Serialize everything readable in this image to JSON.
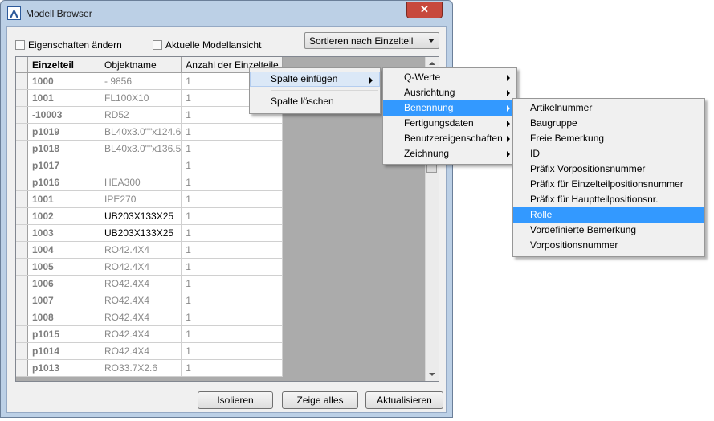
{
  "window": {
    "title": "Modell Browser",
    "close_glyph": "✕"
  },
  "options": {
    "checkbox1_label": "Eigenschaften ändern",
    "checkbox2_label": "Aktuelle Modellansicht",
    "sort_value": "Sortieren nach Einzelteil"
  },
  "table": {
    "columns": [
      "Einzelteil",
      "Objektname",
      "Anzahl der Einzelteile"
    ],
    "rows": [
      {
        "c1": "1000",
        "c2": "- 9856",
        "c3": "1"
      },
      {
        "c1": "1001",
        "c2": "FL100X10",
        "c3": "1"
      },
      {
        "c1": "-10003",
        "c2": "RD52",
        "c3": "1"
      },
      {
        "c1": "p1019",
        "c2": "BL40x3.0\"\"x124.6",
        "c3": "1"
      },
      {
        "c1": "p1018",
        "c2": "BL40x3.0\"\"x136.5",
        "c3": "1"
      },
      {
        "c1": "p1017",
        "c2": "",
        "c3": "1"
      },
      {
        "c1": "p1016",
        "c2": "HEA300",
        "c3": "1"
      },
      {
        "c1": "1001",
        "c2": "IPE270",
        "c3": "1"
      },
      {
        "c1": "1002",
        "c2": "UB203X133X25",
        "c3": "1"
      },
      {
        "c1": "1003",
        "c2": "UB203X133X25",
        "c3": "1"
      },
      {
        "c1": "1004",
        "c2": "RO42.4X4",
        "c3": "1"
      },
      {
        "c1": "1005",
        "c2": "RO42.4X4",
        "c3": "1"
      },
      {
        "c1": "1006",
        "c2": "RO42.4X4",
        "c3": "1"
      },
      {
        "c1": "1007",
        "c2": "RO42.4X4",
        "c3": "1"
      },
      {
        "c1": "1008",
        "c2": "RO42.4X4",
        "c3": "1"
      },
      {
        "c1": "p1015",
        "c2": "RO42.4X4",
        "c3": "1"
      },
      {
        "c1": "p1014",
        "c2": "RO42.4X4",
        "c3": "1"
      },
      {
        "c1": "p1013",
        "c2": "RO33.7X2.6",
        "c3": "1"
      }
    ]
  },
  "buttons": {
    "isolate": "Isolieren",
    "show_all": "Zeige alles",
    "refresh": "Aktualisieren"
  },
  "context_menu": {
    "items": [
      "Spalte einfügen",
      "Spalte löschen"
    ]
  },
  "submenu": {
    "items": [
      "Q-Werte",
      "Ausrichtung",
      "Benennung",
      "Fertigungsdaten",
      "Benutzereigenschaften",
      "Zeichnung"
    ]
  },
  "submenu2": {
    "items": [
      "Artikelnummer",
      "Baugruppe",
      "Freie Bemerkung",
      "ID",
      "Präfix Vorpositionsnummer",
      "Präfix für Einzelteilpositionsnummer",
      "Präfix für Hauptteilpositionsnr.",
      "Rolle",
      "Vordefinierte Bemerkung",
      "Vorpositionsnummer"
    ]
  },
  "colors": {
    "highlight": "#3399ff",
    "window_frame": "#bcd0e6",
    "close_button": "#c7493d"
  }
}
